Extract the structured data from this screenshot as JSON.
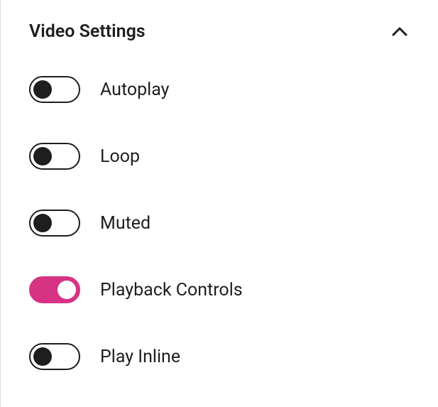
{
  "section": {
    "title": "Video Settings"
  },
  "toggles": {
    "autoplay": {
      "label": "Autoplay",
      "on": false
    },
    "loop": {
      "label": "Loop",
      "on": false
    },
    "muted": {
      "label": "Muted",
      "on": false
    },
    "playback_controls": {
      "label": "Playback Controls",
      "on": true
    },
    "play_inline": {
      "label": "Play Inline",
      "on": false
    }
  }
}
